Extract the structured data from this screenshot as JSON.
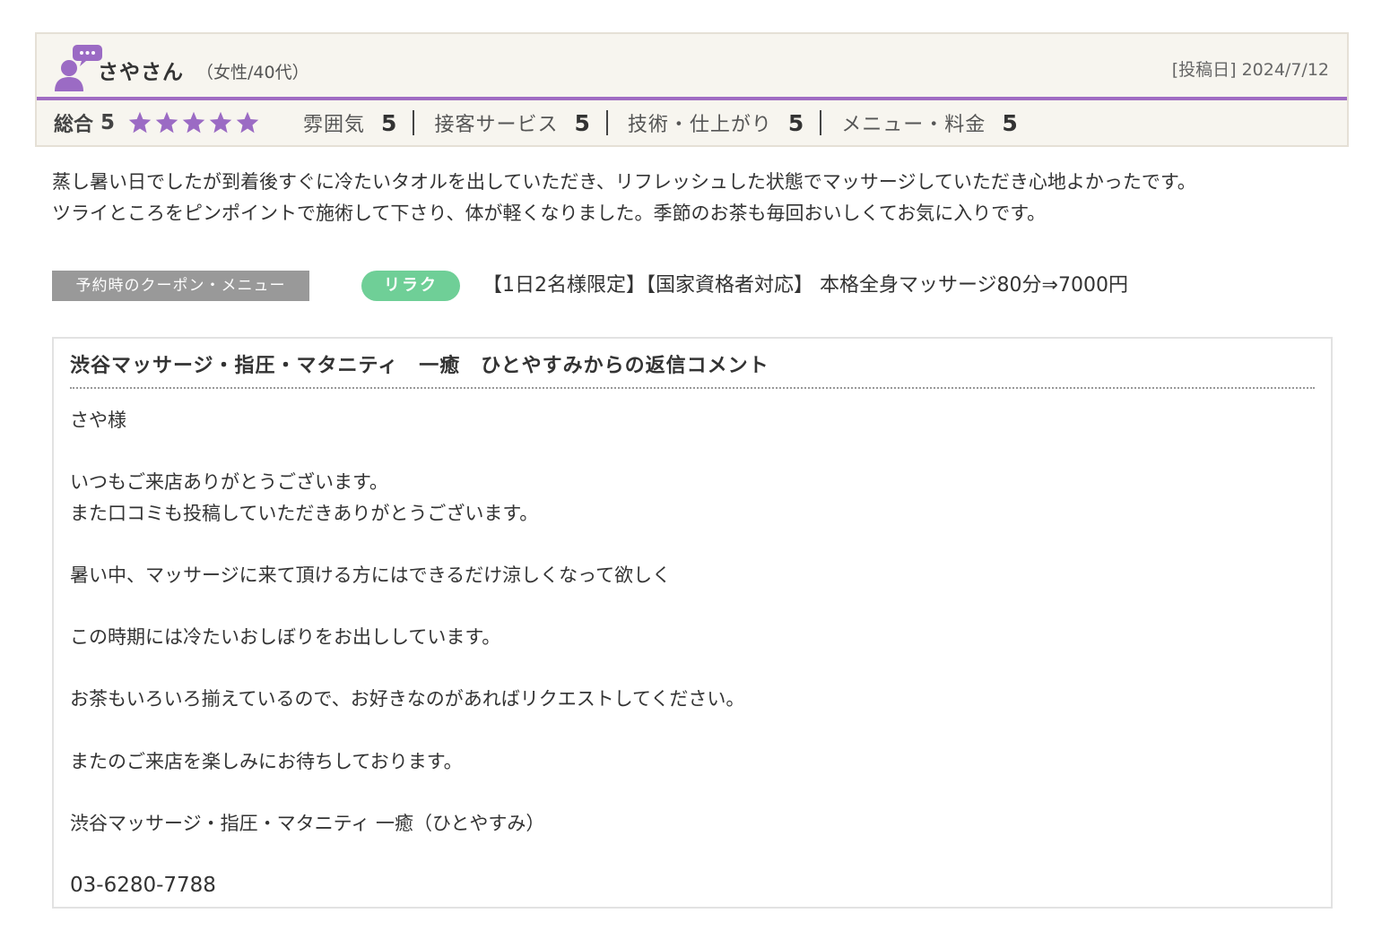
{
  "review": {
    "reviewer_name": "さやさん",
    "reviewer_meta": "（女性/40代）",
    "post_date": "[投稿日] 2024/7/12",
    "overall_label": "総合",
    "overall_score": "5",
    "star_rating": 5,
    "ratings": [
      {
        "label": "雰囲気",
        "score": "5"
      },
      {
        "label": "接客サービス",
        "score": "5"
      },
      {
        "label": "技術・仕上がり",
        "score": "5"
      },
      {
        "label": "メニュー・料金",
        "score": "5"
      }
    ],
    "body_lines": [
      "蒸し暑い日でしたが到着後すぐに冷たいタオルを出していただき、リフレッシュした状態でマッサージしていただき心地よかったです。",
      "ツライところをピンポイントで施術して下さり、体が軽くなりました。季節のお茶も毎回おいしくてお気に入りです。"
    ]
  },
  "coupon": {
    "label": "予約時のクーポン・メニュー",
    "tag": "リラク",
    "text": "【1日2名様限定】【国家資格者対応】 本格全身マッサージ80分⇒7000円"
  },
  "reply": {
    "title": "渋谷マッサージ・指圧・マタニティ　一癒　ひとやすみからの返信コメント",
    "lines": [
      "さや様",
      "",
      "いつもご来店ありがとうございます。",
      "また口コミも投稿していただきありがとうございます。",
      "",
      "暑い中、マッサージに来て頂ける方にはできるだけ涼しくなって欲しく",
      "",
      "この時期には冷たいおしぼりをお出ししています。",
      "",
      "お茶もいろいろ揃えているので、お好きなのがあればリクエストしてください。",
      "",
      "またのご来店を楽しみにお待ちしております。",
      "",
      "渋谷マッサージ・指圧・マタニティ 一癒（ひとやすみ）",
      "",
      "03-6280-7788"
    ]
  },
  "colors": {
    "accent_purple": "#a06cc3",
    "star_purple": "#9b6bc4",
    "tag_green": "#6fcf97",
    "label_gray": "#999999",
    "card_bg": "#f7f5ef"
  },
  "icons": {
    "avatar": "user-comment-icon",
    "star": "star-icon"
  }
}
